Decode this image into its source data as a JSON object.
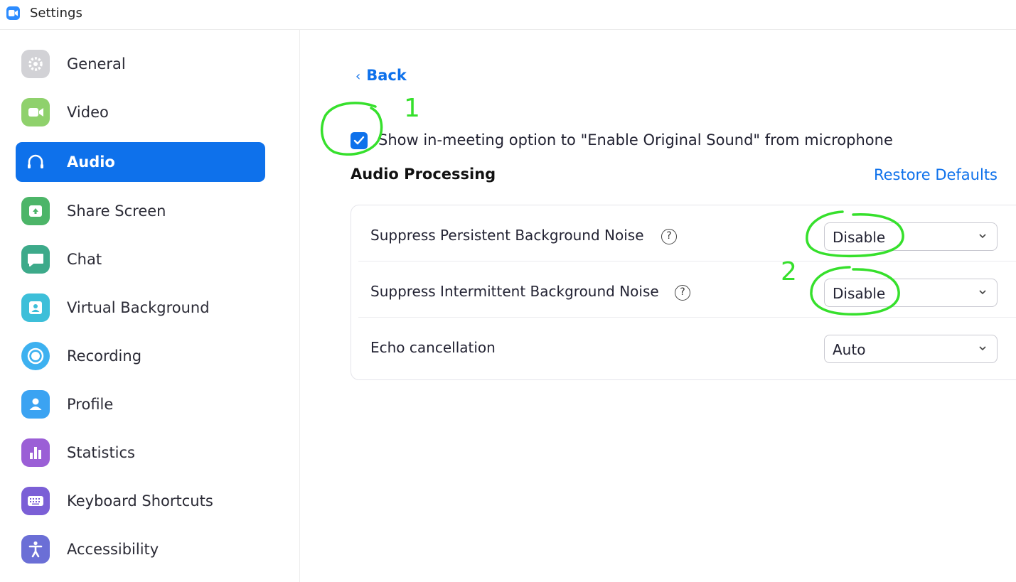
{
  "window": {
    "title": "Settings",
    "app_icon": "zoom-camera-icon"
  },
  "sidebar": {
    "items": [
      {
        "label": "General",
        "icon": "gear-icon",
        "color": "#C8C8CC",
        "active": false
      },
      {
        "label": "Video",
        "icon": "video-camera-icon",
        "color": "#8FD16C",
        "active": false
      },
      {
        "label": "Audio",
        "icon": "headphones-icon",
        "color": "#0E71EB",
        "active": true
      },
      {
        "label": "Share Screen",
        "icon": "share-screen-icon",
        "color": "#4CB568",
        "active": false
      },
      {
        "label": "Chat",
        "icon": "chat-bubble-icon",
        "color": "#3DAA8A",
        "active": false
      },
      {
        "label": "Virtual Background",
        "icon": "virtual-background-icon",
        "color": "#3DBFD9",
        "active": false
      },
      {
        "label": "Recording",
        "icon": "record-icon",
        "color": "#3DB1F0",
        "active": false
      },
      {
        "label": "Profile",
        "icon": "person-icon",
        "color": "#3BA3F2",
        "active": false
      },
      {
        "label": "Statistics",
        "icon": "bar-chart-icon",
        "color": "#9B5FD6",
        "active": false
      },
      {
        "label": "Keyboard Shortcuts",
        "icon": "keyboard-icon",
        "color": "#7B5FD6",
        "active": false
      },
      {
        "label": "Accessibility",
        "icon": "accessibility-icon",
        "color": "#6B6FD6",
        "active": false
      }
    ]
  },
  "main": {
    "back_label": "Back",
    "original_sound_option": {
      "label": "Show in-meeting option to \"Enable Original Sound\" from microphone",
      "checked": true
    },
    "section_title": "Audio Processing",
    "restore_label": "Restore Defaults",
    "rows": [
      {
        "label": "Suppress Persistent Background Noise",
        "has_help": true,
        "value": "Disable"
      },
      {
        "label": "Suppress Intermittent Background Noise",
        "has_help": true,
        "value": "Disable"
      },
      {
        "label": "Echo cancellation",
        "has_help": false,
        "value": "Auto"
      }
    ],
    "help_glyph": "?"
  },
  "annotations": {
    "color": "#36E02C",
    "numbers": [
      "1",
      "2"
    ]
  },
  "colors": {
    "accent": "#0E71EB",
    "annotation": "#36E02C"
  }
}
